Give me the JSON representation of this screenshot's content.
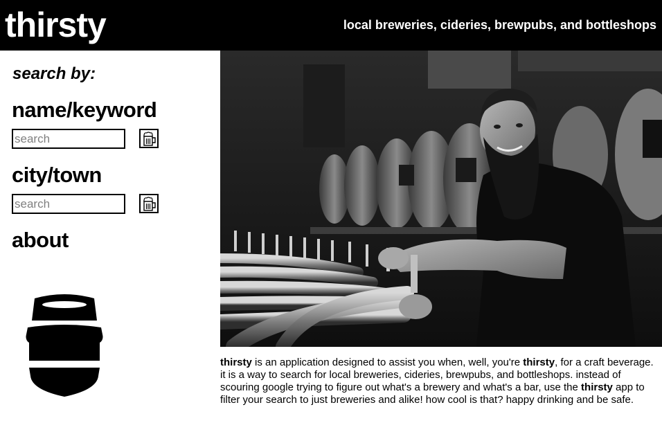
{
  "header": {
    "logo": "thirsty",
    "tagline": "local breweries, cideries, brewpubs, and bottleshops"
  },
  "sidebar": {
    "search_by": "search by:",
    "name_section": {
      "heading": "name/keyword",
      "placeholder": "search",
      "button_icon": "beer-mug-icon"
    },
    "city_section": {
      "heading": "city/town",
      "placeholder": "search",
      "button_icon": "beer-mug-icon"
    },
    "about_link": "about",
    "logo_icon": "keg-icon"
  },
  "hero": {
    "image": "bartender-pulling-tap-photo"
  },
  "about": {
    "brand": "thirsty",
    "p1": " is an application designed to assist you when, well, you're ",
    "p2": ", for a craft beverage. it is a way to search for local breweries, cideries, brewpubs, and bottleshops. instead of scouring google trying to figure out what's a brewery and what's a bar, use the ",
    "p3": " app to filter your search to just breweries and alike! how cool is that? happy drinking and be safe."
  },
  "colors": {
    "header_bg": "#000000",
    "header_text": "#ffffff",
    "placeholder": "#808080"
  }
}
